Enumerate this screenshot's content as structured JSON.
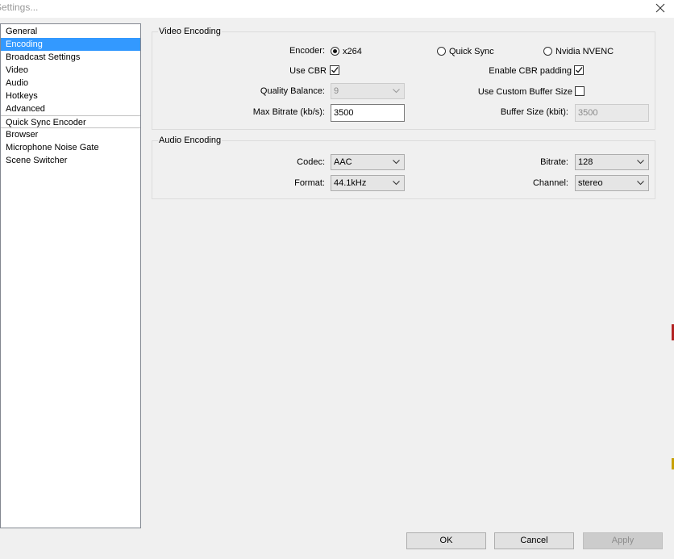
{
  "window": {
    "title": "Settings..."
  },
  "nav": {
    "items": [
      "General",
      "Encoding",
      "Broadcast Settings",
      "Video",
      "Audio",
      "Hotkeys",
      "Advanced",
      "Quick Sync Encoder",
      "Browser",
      "Microphone Noise Gate",
      "Scene Switcher"
    ],
    "selected": "Encoding"
  },
  "video_encoding": {
    "title": "Video Encoding",
    "encoder_label": "Encoder:",
    "encoder_options": [
      "x264",
      "Quick Sync",
      "Nvidia NVENC"
    ],
    "encoder_selected": "x264",
    "use_cbr_label": "Use CBR",
    "use_cbr_checked": true,
    "enable_cbr_padding_label": "Enable CBR padding",
    "enable_cbr_padding_checked": true,
    "quality_balance_label": "Quality Balance:",
    "quality_balance_value": "9",
    "use_custom_buffer_label": "Use Custom Buffer Size",
    "use_custom_buffer_checked": false,
    "max_bitrate_label": "Max Bitrate (kb/s):",
    "max_bitrate_value": "3500",
    "buffer_size_label": "Buffer Size (kbit):",
    "buffer_size_value": "3500"
  },
  "audio_encoding": {
    "title": "Audio Encoding",
    "codec_label": "Codec:",
    "codec_value": "AAC",
    "bitrate_label": "Bitrate:",
    "bitrate_value": "128",
    "format_label": "Format:",
    "format_value": "44.1kHz",
    "channel_label": "Channel:",
    "channel_value": "stereo"
  },
  "buttons": {
    "ok": "OK",
    "cancel": "Cancel",
    "apply": "Apply"
  },
  "icons": {
    "close": "close-icon",
    "dropdown": "chevron-down-icon",
    "check": "check-icon"
  }
}
